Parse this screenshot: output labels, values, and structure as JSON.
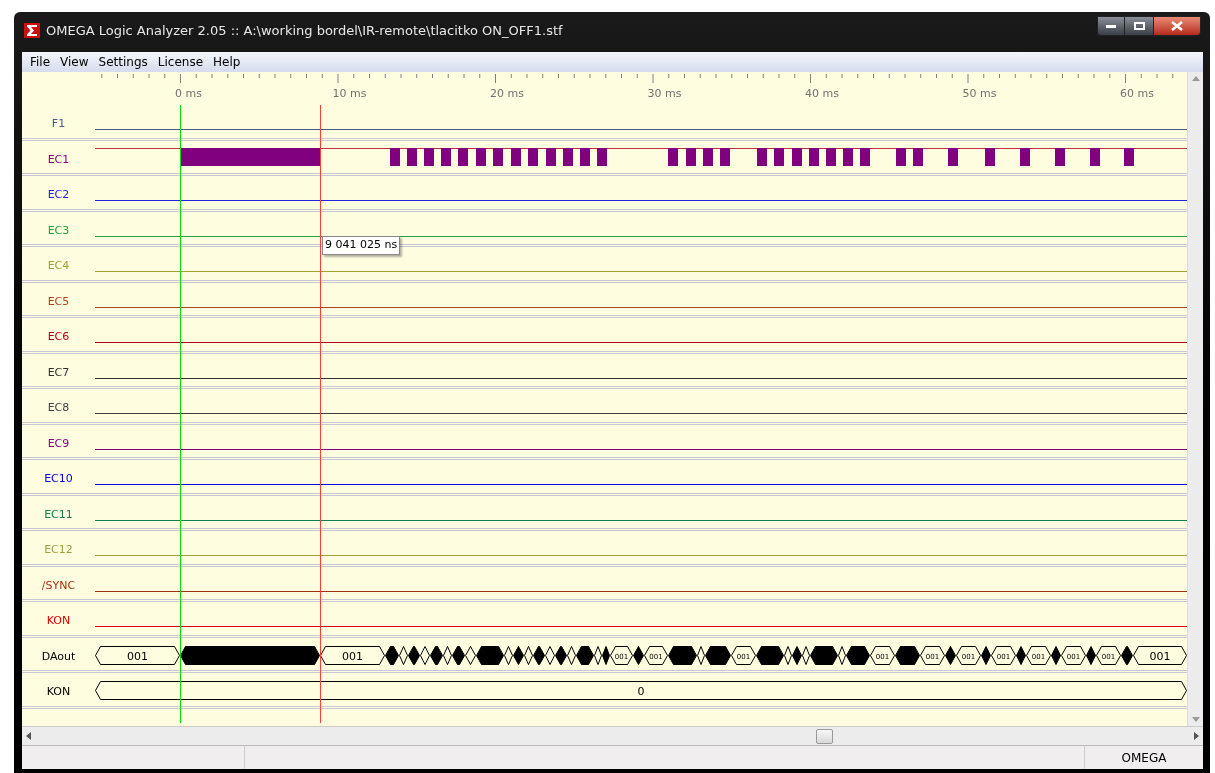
{
  "window": {
    "title": "OMEGA Logic Analyzer 2.05 :: A:\\working bordel\\IR-remote\\tlacitko ON_OFF1.stf"
  },
  "menu": [
    "File",
    "View",
    "Settings",
    "License",
    "Help"
  ],
  "ruler": [
    "0 ms",
    "10 ms",
    "20 ms",
    "30 ms",
    "40 ms",
    "50 ms",
    "60 ms"
  ],
  "channels": [
    {
      "name": "F1",
      "kind": "line",
      "color": "#4a5a8a"
    },
    {
      "name": "EC1",
      "kind": "pulses",
      "color": "#800080"
    },
    {
      "name": "EC2",
      "kind": "line",
      "color": "#2020e0"
    },
    {
      "name": "EC3",
      "kind": "line",
      "color": "#20a040"
    },
    {
      "name": "EC4",
      "kind": "line",
      "color": "#a0a030"
    },
    {
      "name": "EC5",
      "kind": "line",
      "color": "#b04020"
    },
    {
      "name": "EC6",
      "kind": "line",
      "color": "#b00020"
    },
    {
      "name": "EC7",
      "kind": "line",
      "color": "#303030"
    },
    {
      "name": "EC8",
      "kind": "line",
      "color": "#404040"
    },
    {
      "name": "EC9",
      "kind": "line",
      "color": "#800080"
    },
    {
      "name": "EC10",
      "kind": "line",
      "color": "#0000e0"
    },
    {
      "name": "EC11",
      "kind": "line",
      "color": "#108050"
    },
    {
      "name": "EC12",
      "kind": "line",
      "color": "#a0a040"
    },
    {
      "name": "/SYNC",
      "kind": "line",
      "color": "#a03010"
    },
    {
      "name": "KON",
      "kind": "line",
      "color": "#e00000"
    },
    {
      "name": "DAout",
      "kind": "bus",
      "color": "#000000",
      "values": [
        "001",
        "001",
        "001",
        "001",
        "001",
        "001",
        "001",
        "001",
        "001",
        "001",
        "001",
        "001",
        "001"
      ]
    },
    {
      "name": "KON",
      "kind": "bus",
      "color": "#000000",
      "values": [
        "0"
      ]
    }
  ],
  "cursor_readout": "9 041 025 ns",
  "status_bar": [
    "OMEGA"
  ]
}
